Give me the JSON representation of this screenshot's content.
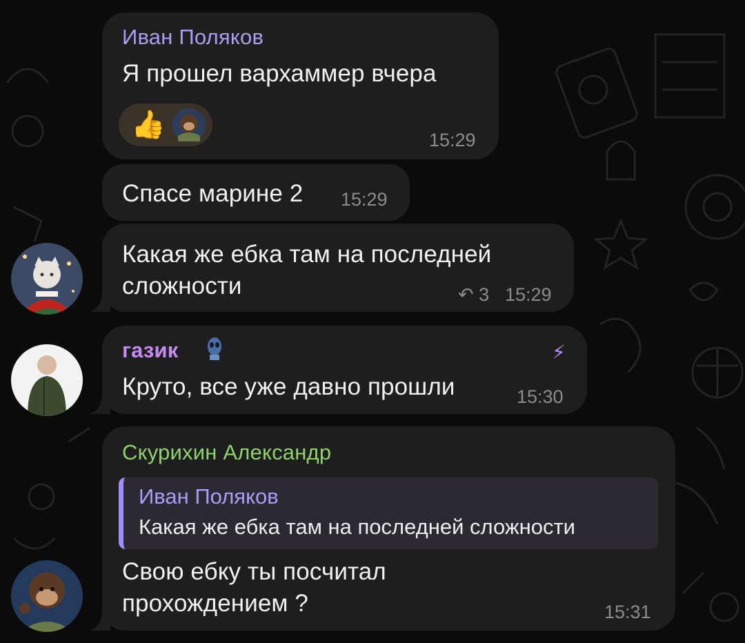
{
  "messages": [
    {
      "sender": "Иван Поляков",
      "text": "Я прошел вархаммер вчера",
      "time": "15:29",
      "reactions": {
        "emoji": "👍",
        "avatar": "astronaut-monkey-avatar"
      }
    },
    {
      "text": "Спасе марине 2",
      "time": "15:29"
    },
    {
      "text_lines": [
        "Какая же ебка там на последней",
        "сложности"
      ],
      "time": "15:29",
      "reply_count": "3"
    },
    {
      "sender": "газик",
      "text": "Круто, все уже давно прошли",
      "time": "15:30",
      "badge_icon": "stitch-sticker-icon",
      "boost_icon": "lightning-icon"
    },
    {
      "sender": "Скурихин Александр",
      "quote": {
        "sender": "Иван Поляков",
        "text": "Какая же ебка там на последней сложности"
      },
      "text_lines": [
        "Свою ебку ты посчитал",
        "прохождением ?"
      ],
      "time": "15:31"
    }
  ],
  "colors": {
    "bubble": "#1e1e1e",
    "name_ivan": "#ad9cf7",
    "name_gazik": "#c48cf2",
    "name_skurikhin": "#8fd16b",
    "quote_bar": "#a08cff",
    "time": "#8c8c8c",
    "text": "#f1f1f1"
  }
}
